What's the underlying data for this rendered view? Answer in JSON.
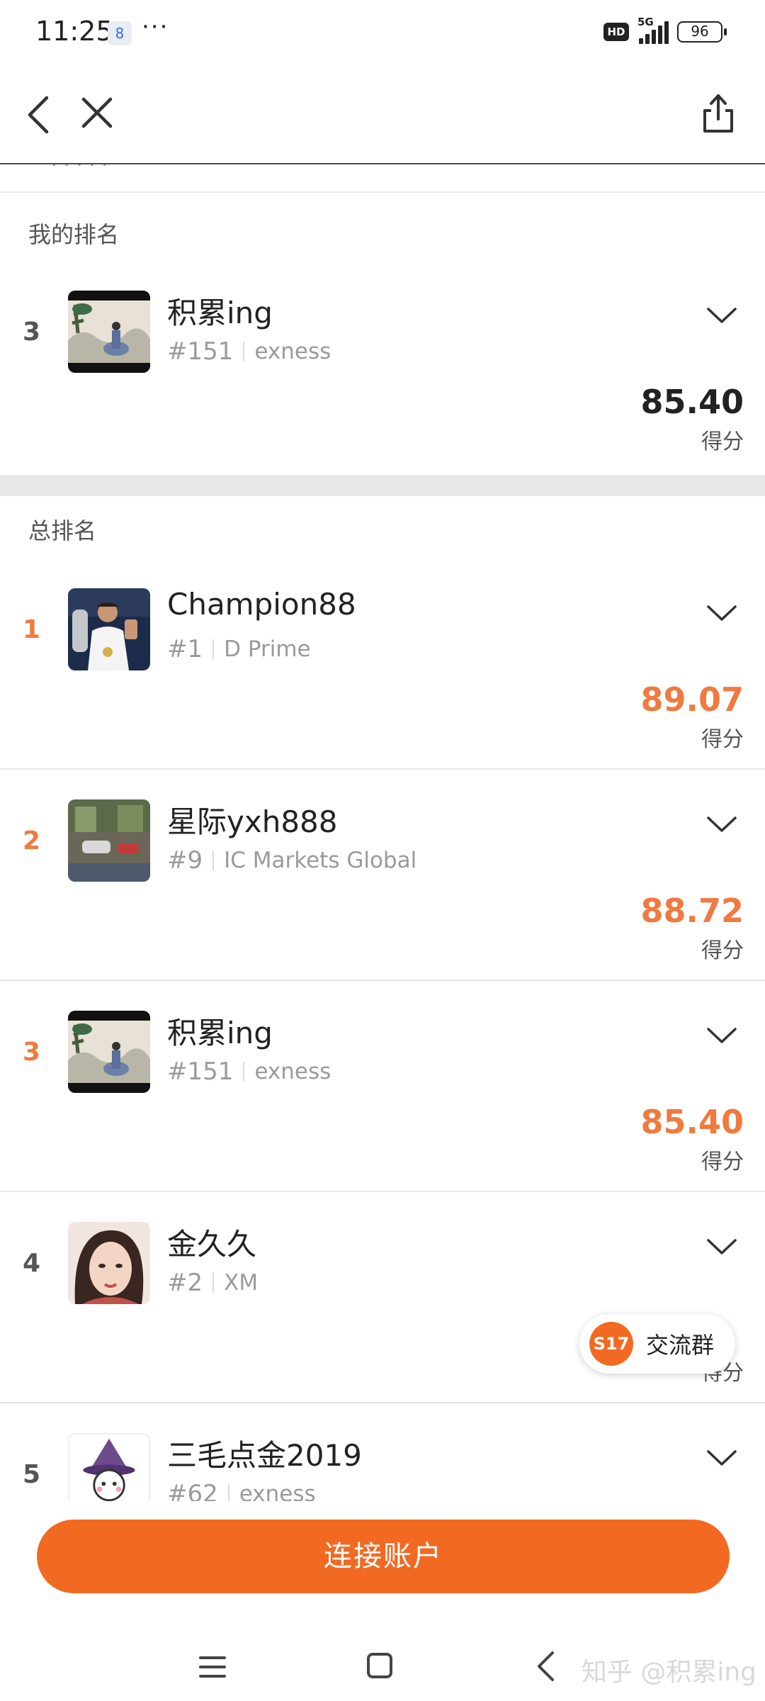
{
  "status_bar": {
    "time": "11:25",
    "notif_icon": "8",
    "more": "···",
    "hd": "HD",
    "network": "5G",
    "battery": "96"
  },
  "nav": {
    "back_icon": "chevron-left-icon",
    "close_icon": "close-icon",
    "share_icon": "share-icon"
  },
  "my_rank": {
    "title": "我的排名",
    "entry": {
      "rank": "3",
      "name": "积累ing",
      "num": "#151",
      "broker": "exness",
      "score": "85.40",
      "score_label": "得分"
    }
  },
  "overall": {
    "title": "总排名",
    "entries": [
      {
        "rank": "1",
        "name": "Champion88",
        "num": "#1",
        "broker": "D Prime",
        "score": "89.07",
        "score_label": "得分"
      },
      {
        "rank": "2",
        "name": "星际yxh888",
        "num": "#9",
        "broker": "IC Markets Global",
        "score": "88.72",
        "score_label": "得分"
      },
      {
        "rank": "3",
        "name": "积累ing",
        "num": "#151",
        "broker": "exness",
        "score": "85.40",
        "score_label": "得分"
      },
      {
        "rank": "4",
        "name": "金久久",
        "num": "#2",
        "broker": "XM",
        "score": "",
        "score_label": "得分"
      },
      {
        "rank": "5",
        "name": "三毛点金2019",
        "num": "#62",
        "broker": "exness",
        "score": "",
        "score_label": ""
      }
    ]
  },
  "chat_pill": {
    "badge": "S17",
    "label": "交流群"
  },
  "connect_button": "连接账户",
  "watermark": "知乎 @积累ing",
  "colors": {
    "accent": "#f26a22",
    "rank_top": "#f07a3f"
  }
}
